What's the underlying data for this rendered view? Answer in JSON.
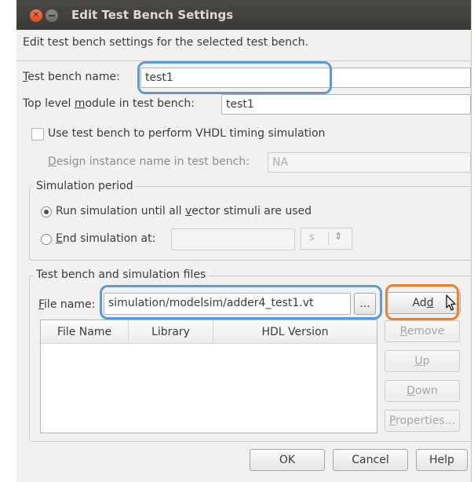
{
  "window": {
    "title": "Edit Test Bench Settings"
  },
  "description": "Edit test bench settings for the selected test bench.",
  "fields": {
    "tb_name_label_pre": "T",
    "tb_name_label_post": "est bench name:",
    "tb_name_value": "test1",
    "top_module_label_pre": "Top level ",
    "top_module_label_u": "m",
    "top_module_label_post": "odule in test bench:",
    "top_module_value": "test1",
    "vhdl_timing_label": "Use test bench to perform VHDL timing simulation",
    "design_instance_label_u": "D",
    "design_instance_label_post": "esign instance name in test bench:",
    "design_instance_value": "NA"
  },
  "simulation_period": {
    "title": "Simulation period",
    "run_all_pre": "Run simulation until all ",
    "run_all_u": "v",
    "run_all_post": "ector stimuli are used",
    "end_at_u": "E",
    "end_at_post": "nd simulation at:",
    "end_value": "",
    "unit": "s",
    "selected": "run_all"
  },
  "files": {
    "title": "Test bench and simulation files",
    "file_name_label_u": "F",
    "file_name_label_post": "ile name:",
    "file_name_value": "simulation/modelsim/adder4_test1.vt",
    "browse_label": "...",
    "add_pre": "Ad",
    "add_u": "d",
    "columns": [
      "File Name",
      "Library",
      "HDL Version"
    ],
    "remove_u": "R",
    "remove_post": "emove",
    "up_u": "U",
    "up_post": "p",
    "down_u": "D",
    "down_post": "own",
    "properties_u": "P",
    "properties_post": "roperties..."
  },
  "footer": {
    "ok": "OK",
    "cancel": "Cancel",
    "help": "Help"
  },
  "colors": {
    "highlight_blue": "#5b9bd5",
    "highlight_orange": "#ed7d31"
  }
}
